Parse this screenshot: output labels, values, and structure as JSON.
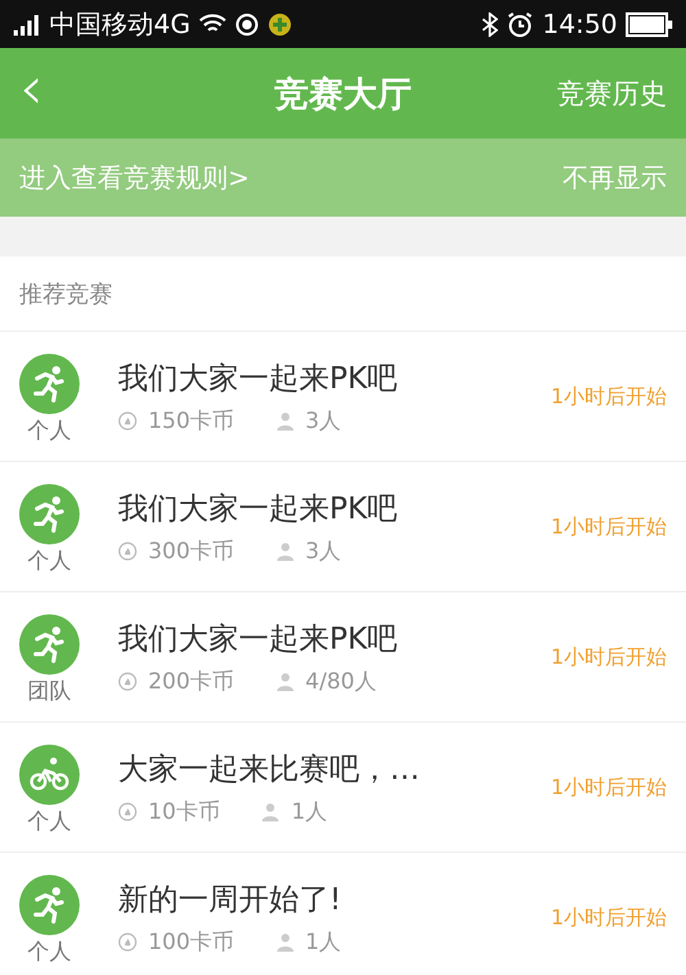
{
  "status_bar": {
    "carrier": "中国移动4G",
    "time": "14:50"
  },
  "header": {
    "back": "‹",
    "title": "竞赛大厅",
    "action": "竞赛历史"
  },
  "banner": {
    "link": "进入查看竞赛规则>",
    "dismiss": "不再显示"
  },
  "section": {
    "title": "推荐竞赛"
  },
  "competitions": [
    {
      "kind": "run",
      "type": "个人",
      "title": "我们大家一起来PK吧",
      "coins": "150卡币",
      "people": "3人",
      "start": "1小时后开始"
    },
    {
      "kind": "run",
      "type": "个人",
      "title": "我们大家一起来PK吧",
      "coins": "300卡币",
      "people": "3人",
      "start": "1小时后开始"
    },
    {
      "kind": "run",
      "type": "团队",
      "title": "我们大家一起来PK吧",
      "coins": "200卡币",
      "people": "4/80人",
      "start": "1小时后开始"
    },
    {
      "kind": "bike",
      "type": "个人",
      "title": "大家一起来比赛吧，…",
      "coins": "10卡币",
      "people": "1人",
      "start": "1小时后开始"
    },
    {
      "kind": "run",
      "type": "个人",
      "title": "新的一周开始了!",
      "coins": "100卡币",
      "people": "1人",
      "start": "1小时后开始"
    }
  ]
}
